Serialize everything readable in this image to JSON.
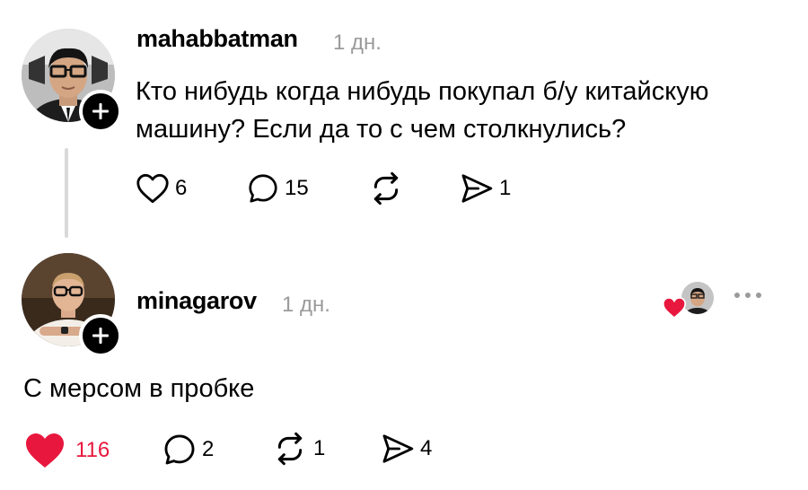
{
  "post": {
    "username": "mahabbatman",
    "time": "1 дн.",
    "text_line1": "Кто нибудь когда нибудь покупал б/у китайскую",
    "text_line2": "машину? Если да то с чем столкнулись?",
    "likes": "6",
    "comments": "15",
    "shares": "1"
  },
  "reply": {
    "username": "minagarov",
    "time": "1 дн.",
    "text": "С мерсом в пробке",
    "likes": "116",
    "comments": "2",
    "reposts": "1",
    "shares": "4"
  },
  "colors": {
    "like_red": "#e8173d",
    "muted": "#9a9a9a"
  },
  "icons": [
    "heart-icon",
    "comment-icon",
    "repost-icon",
    "share-icon",
    "plus-icon",
    "more-icon"
  ]
}
